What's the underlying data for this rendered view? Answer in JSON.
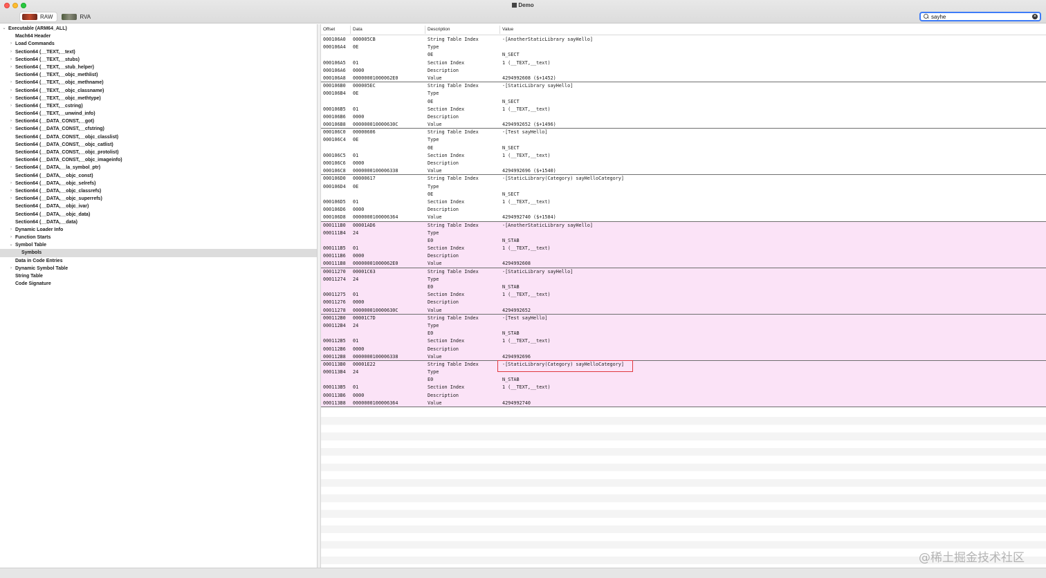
{
  "window": {
    "title": "Demo"
  },
  "toolbar": {
    "raw_label": "RAW",
    "rva_label": "RVA",
    "search_value": "sayhe"
  },
  "sidebar": {
    "items": [
      {
        "label": "Executable  (ARM64_ALL)",
        "level": 0,
        "disclosure": "open"
      },
      {
        "label": "Mach64 Header",
        "level": 1,
        "disclosure": "none"
      },
      {
        "label": "Load Commands",
        "level": 1,
        "disclosure": "closed"
      },
      {
        "label": "Section64 (__TEXT,__text)",
        "level": 1,
        "disclosure": "closed"
      },
      {
        "label": "Section64 (__TEXT,__stubs)",
        "level": 1,
        "disclosure": "closed"
      },
      {
        "label": "Section64 (__TEXT,__stub_helper)",
        "level": 1,
        "disclosure": "closed"
      },
      {
        "label": "Section64 (__TEXT,__objc_methlist)",
        "level": 1,
        "disclosure": "none"
      },
      {
        "label": "Section64 (__TEXT,__objc_methname)",
        "level": 1,
        "disclosure": "closed"
      },
      {
        "label": "Section64 (__TEXT,__objc_classname)",
        "level": 1,
        "disclosure": "closed"
      },
      {
        "label": "Section64 (__TEXT,__objc_methtype)",
        "level": 1,
        "disclosure": "closed"
      },
      {
        "label": "Section64 (__TEXT,__cstring)",
        "level": 1,
        "disclosure": "closed"
      },
      {
        "label": "Section64 (__TEXT,__unwind_info)",
        "level": 1,
        "disclosure": "none"
      },
      {
        "label": "Section64 (__DATA_CONST,__got)",
        "level": 1,
        "disclosure": "closed"
      },
      {
        "label": "Section64 (__DATA_CONST,__cfstring)",
        "level": 1,
        "disclosure": "closed"
      },
      {
        "label": "Section64 (__DATA_CONST,__objc_classlist)",
        "level": 1,
        "disclosure": "none"
      },
      {
        "label": "Section64 (__DATA_CONST,__objc_catlist)",
        "level": 1,
        "disclosure": "none"
      },
      {
        "label": "Section64 (__DATA_CONST,__objc_protolist)",
        "level": 1,
        "disclosure": "none"
      },
      {
        "label": "Section64 (__DATA_CONST,__objc_imageinfo)",
        "level": 1,
        "disclosure": "none"
      },
      {
        "label": "Section64 (__DATA,__la_symbol_ptr)",
        "level": 1,
        "disclosure": "closed"
      },
      {
        "label": "Section64 (__DATA,__objc_const)",
        "level": 1,
        "disclosure": "none"
      },
      {
        "label": "Section64 (__DATA,__objc_selrefs)",
        "level": 1,
        "disclosure": "closed"
      },
      {
        "label": "Section64 (__DATA,__objc_classrefs)",
        "level": 1,
        "disclosure": "closed"
      },
      {
        "label": "Section64 (__DATA,__objc_superrefs)",
        "level": 1,
        "disclosure": "closed"
      },
      {
        "label": "Section64 (__DATA,__objc_ivar)",
        "level": 1,
        "disclosure": "none"
      },
      {
        "label": "Section64 (__DATA,__objc_data)",
        "level": 1,
        "disclosure": "none"
      },
      {
        "label": "Section64 (__DATA,__data)",
        "level": 1,
        "disclosure": "none"
      },
      {
        "label": "Dynamic Loader Info",
        "level": 1,
        "disclosure": "closed"
      },
      {
        "label": "Function Starts",
        "level": 1,
        "disclosure": "closed"
      },
      {
        "label": "Symbol Table",
        "level": 1,
        "disclosure": "open"
      },
      {
        "label": "Symbols",
        "level": 2,
        "disclosure": "none",
        "selected": true
      },
      {
        "label": "Data in Code Entries",
        "level": 1,
        "disclosure": "none"
      },
      {
        "label": "Dynamic Symbol Table",
        "level": 1,
        "disclosure": "closed"
      },
      {
        "label": "String Table",
        "level": 1,
        "disclosure": "none"
      },
      {
        "label": "Code Signature",
        "level": 1,
        "disclosure": "none"
      }
    ]
  },
  "table": {
    "columns": [
      "Offset",
      "Data",
      "Description",
      "Value"
    ],
    "rows": [
      {
        "offset": "000106A0",
        "data": "000005CB",
        "desc": "String Table Index",
        "value": "-[AnotherStaticLibrary sayHello]"
      },
      {
        "offset": "000106A4",
        "data": "0E",
        "desc": "Type",
        "value": ""
      },
      {
        "offset": "",
        "data": "",
        "desc": "0E",
        "value": "N_SECT"
      },
      {
        "offset": "000106A5",
        "data": "01",
        "desc": "Section Index",
        "value": "1 (__TEXT,__text)"
      },
      {
        "offset": "000106A6",
        "data": "0000",
        "desc": "Description",
        "value": ""
      },
      {
        "offset": "000106A8",
        "data": "00000001000062E0",
        "desc": "Value",
        "value": "4294992608 ($+1452)",
        "sep": true
      },
      {
        "offset": "000106B0",
        "data": "000005EC",
        "desc": "String Table Index",
        "value": "-[StaticLibrary sayHello]"
      },
      {
        "offset": "000106B4",
        "data": "0E",
        "desc": "Type",
        "value": ""
      },
      {
        "offset": "",
        "data": "",
        "desc": "0E",
        "value": "N_SECT"
      },
      {
        "offset": "000106B5",
        "data": "01",
        "desc": "Section Index",
        "value": "1 (__TEXT,__text)"
      },
      {
        "offset": "000106B6",
        "data": "0000",
        "desc": "Description",
        "value": ""
      },
      {
        "offset": "000106B8",
        "data": "000000010000630C",
        "desc": "Value",
        "value": "4294992652 ($+1496)",
        "sep": true
      },
      {
        "offset": "000106C0",
        "data": "00000606",
        "desc": "String Table Index",
        "value": "-[Test sayHello]"
      },
      {
        "offset": "000106C4",
        "data": "0E",
        "desc": "Type",
        "value": ""
      },
      {
        "offset": "",
        "data": "",
        "desc": "0E",
        "value": "N_SECT"
      },
      {
        "offset": "000106C5",
        "data": "01",
        "desc": "Section Index",
        "value": "1 (__TEXT,__text)"
      },
      {
        "offset": "000106C6",
        "data": "0000",
        "desc": "Description",
        "value": ""
      },
      {
        "offset": "000106C8",
        "data": "0000000100006338",
        "desc": "Value",
        "value": "4294992696 ($+1540)",
        "sep": true
      },
      {
        "offset": "000106D0",
        "data": "00000617",
        "desc": "String Table Index",
        "value": "-[StaticLibrary(Category) sayHelloCategory]"
      },
      {
        "offset": "000106D4",
        "data": "0E",
        "desc": "Type",
        "value": ""
      },
      {
        "offset": "",
        "data": "",
        "desc": "0E",
        "value": "N_SECT"
      },
      {
        "offset": "000106D5",
        "data": "01",
        "desc": "Section Index",
        "value": "1 (__TEXT,__text)"
      },
      {
        "offset": "000106D6",
        "data": "0000",
        "desc": "Description",
        "value": ""
      },
      {
        "offset": "000106D8",
        "data": "0000000100006364",
        "desc": "Value",
        "value": "4294992740 ($+1584)",
        "sep": true
      },
      {
        "offset": "000111B0",
        "data": "00001AD6",
        "desc": "String Table Index",
        "value": "-[AnotherStaticLibrary sayHello]",
        "pink": true
      },
      {
        "offset": "000111B4",
        "data": "24",
        "desc": "Type",
        "value": "",
        "pink": true
      },
      {
        "offset": "",
        "data": "",
        "desc": "E0",
        "value": "N_STAB",
        "pink": true
      },
      {
        "offset": "000111B5",
        "data": "01",
        "desc": "Section Index",
        "value": "1 (__TEXT,__text)",
        "pink": true
      },
      {
        "offset": "000111B6",
        "data": "0000",
        "desc": "Description",
        "value": "",
        "pink": true
      },
      {
        "offset": "000111B8",
        "data": "00000001000062E0",
        "desc": "Value",
        "value": "4294992608",
        "pink": true,
        "sep": true
      },
      {
        "offset": "00011270",
        "data": "00001C63",
        "desc": "String Table Index",
        "value": "-[StaticLibrary sayHello]",
        "pink": true
      },
      {
        "offset": "00011274",
        "data": "24",
        "desc": "Type",
        "value": "",
        "pink": true
      },
      {
        "offset": "",
        "data": "",
        "desc": "E0",
        "value": "N_STAB",
        "pink": true
      },
      {
        "offset": "00011275",
        "data": "01",
        "desc": "Section Index",
        "value": "1 (__TEXT,__text)",
        "pink": true
      },
      {
        "offset": "00011276",
        "data": "0000",
        "desc": "Description",
        "value": "",
        "pink": true
      },
      {
        "offset": "00011278",
        "data": "000000010000630C",
        "desc": "Value",
        "value": "4294992652",
        "pink": true,
        "sep": true
      },
      {
        "offset": "000112B0",
        "data": "00001C7D",
        "desc": "String Table Index",
        "value": "-[Test sayHello]",
        "pink": true
      },
      {
        "offset": "000112B4",
        "data": "24",
        "desc": "Type",
        "value": "",
        "pink": true
      },
      {
        "offset": "",
        "data": "",
        "desc": "E0",
        "value": "N_STAB",
        "pink": true
      },
      {
        "offset": "000112B5",
        "data": "01",
        "desc": "Section Index",
        "value": "1 (__TEXT,__text)",
        "pink": true
      },
      {
        "offset": "000112B6",
        "data": "0000",
        "desc": "Description",
        "value": "",
        "pink": true
      },
      {
        "offset": "000112B8",
        "data": "0000000100006338",
        "desc": "Value",
        "value": "4294992696",
        "pink": true,
        "sep": true
      },
      {
        "offset": "000113B0",
        "data": "00001E22",
        "desc": "String Table Index",
        "value": "-[StaticLibrary(Category) sayHelloCategory]",
        "pink": true
      },
      {
        "offset": "000113B4",
        "data": "24",
        "desc": "Type",
        "value": "",
        "pink": true
      },
      {
        "offset": "",
        "data": "",
        "desc": "E0",
        "value": "N_STAB",
        "pink": true
      },
      {
        "offset": "000113B5",
        "data": "01",
        "desc": "Section Index",
        "value": "1 (__TEXT,__text)",
        "pink": true
      },
      {
        "offset": "000113B6",
        "data": "0000",
        "desc": "Description",
        "value": "",
        "pink": true
      },
      {
        "offset": "000113B8",
        "data": "0000000100006364",
        "desc": "Value",
        "value": "4294992740",
        "pink": true,
        "sep": true
      }
    ]
  },
  "watermark": "@稀土掘金技术社区",
  "colors": {
    "pink_row": "#fbe3f7",
    "highlight_border": "#e0383e",
    "search_focus": "#3d7bf7",
    "selected_row": "#dcdcdc"
  }
}
